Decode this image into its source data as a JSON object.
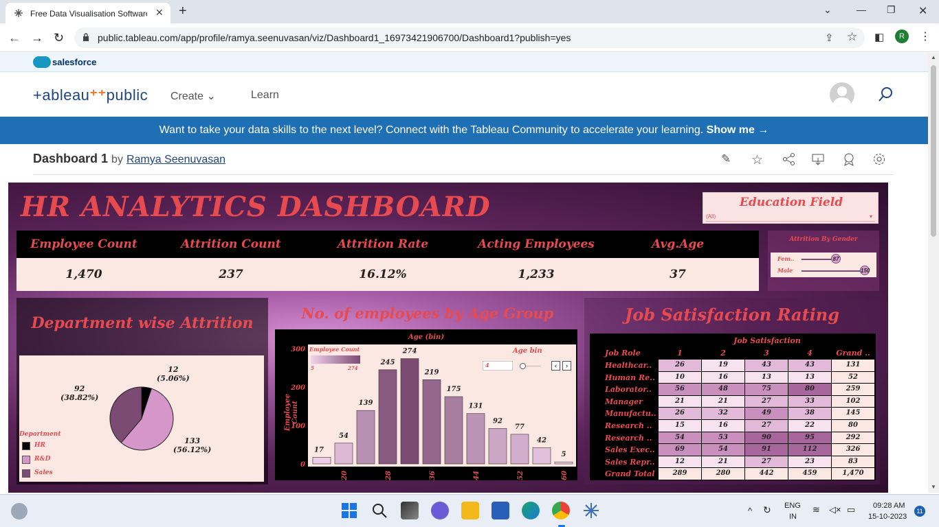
{
  "browser": {
    "tab_title": "Free Data Visualisation Software",
    "new_tab": "+",
    "url": "public.tableau.com/app/profile/ramya.seenuvasan/viz/Dashboard1_16973421906700/Dashboard1?publish=yes",
    "profile_initial": "R"
  },
  "salesforce": {
    "label": "salesforce"
  },
  "tableau": {
    "logo_main": "+ableau",
    "logo_public": "public",
    "menu_create": "Create",
    "menu_learn": "Learn",
    "banner_text": "Want to take your data skills to the next level? Connect with the Tableau Community to accelerate your learning.",
    "banner_link": "Show me →",
    "viz_title": "Dashboard 1",
    "by": "by",
    "author": "Ramya Seenuvasan"
  },
  "dashboard": {
    "title": "HR ANALYTICS DASHBOARD",
    "filter_label": "Education Field",
    "filter_value": "(All)",
    "kpis": [
      {
        "label": "Employee Count",
        "value": "1,470"
      },
      {
        "label": "Attrition Count",
        "value": "237"
      },
      {
        "label": "Attrition Rate",
        "value": "16.12%"
      },
      {
        "label": "Acting Employees",
        "value": "1,233"
      },
      {
        "label": "Avg.Age",
        "value": "37"
      }
    ],
    "gender": {
      "title": "Attrition By Gender",
      "rows": [
        {
          "label": "Fem..",
          "value": "87"
        },
        {
          "label": "Male",
          "value": "150"
        }
      ]
    },
    "department": {
      "title": "Department wise Attrition",
      "legend_title": "Department",
      "slices": [
        {
          "name": "HR",
          "value": 12,
          "pct": "(5.06%)",
          "color": "#000000"
        },
        {
          "name": "R&D",
          "value": 133,
          "pct": "(56.12%)",
          "color": "#d596c9"
        },
        {
          "name": "Sales",
          "value": 92,
          "pct": "(38.82%)",
          "color": "#7b4b74"
        }
      ]
    },
    "age": {
      "title": "No. of employees by Age Group",
      "top_label": "Age (bin)",
      "ylabel": "Employee Count",
      "legend_title": "Employee Count",
      "legend_min": "5",
      "legend_max": "274",
      "param_label": "Age bin",
      "param_value": "4"
    },
    "job": {
      "title": "Job Satisfaction Rating",
      "col_header": "Job Satisfaction",
      "row_header": "Job Role",
      "columns": [
        "1",
        "2",
        "3",
        "4",
        "Grand .."
      ],
      "rows": [
        {
          "role": "Healthcar..",
          "vals": [
            "26",
            "19",
            "43",
            "43",
            "131"
          ]
        },
        {
          "role": "Human Re..",
          "vals": [
            "10",
            "16",
            "13",
            "13",
            "52"
          ]
        },
        {
          "role": "Laborator..",
          "vals": [
            "56",
            "48",
            "75",
            "80",
            "259"
          ]
        },
        {
          "role": "Manager",
          "vals": [
            "21",
            "21",
            "27",
            "33",
            "102"
          ]
        },
        {
          "role": "Manufactu..",
          "vals": [
            "26",
            "32",
            "49",
            "38",
            "145"
          ]
        },
        {
          "role": "Research ..",
          "vals": [
            "15",
            "16",
            "27",
            "22",
            "80"
          ]
        },
        {
          "role": "Research ..",
          "vals": [
            "54",
            "53",
            "90",
            "95",
            "292"
          ]
        },
        {
          "role": "Sales Exec..",
          "vals": [
            "69",
            "54",
            "91",
            "112",
            "326"
          ]
        },
        {
          "role": "Sales Repr..",
          "vals": [
            "12",
            "21",
            "27",
            "23",
            "83"
          ]
        },
        {
          "role": "Grand Total",
          "vals": [
            "289",
            "280",
            "442",
            "459",
            "1,470"
          ]
        }
      ]
    }
  },
  "chart_data": {
    "type": "bar",
    "title": "No. of employees by Age Group",
    "xlabel": "Age (bin)",
    "ylabel": "Employee Count",
    "categories": [
      "16",
      "20",
      "24",
      "28",
      "32",
      "36",
      "40",
      "44",
      "48",
      "52",
      "56",
      "60"
    ],
    "tick_labels": [
      "20",
      "28",
      "36",
      "44",
      "52",
      "60"
    ],
    "values": [
      17,
      54,
      139,
      245,
      274,
      219,
      175,
      131,
      92,
      77,
      42,
      5
    ],
    "ylim": [
      0,
      300
    ],
    "yticks": [
      "0",
      "100",
      "200",
      "300"
    ]
  },
  "taskbar": {
    "lang": "ENG",
    "region": "IN",
    "time": "09:28 AM",
    "date": "15-10-2023",
    "notif": "11"
  }
}
